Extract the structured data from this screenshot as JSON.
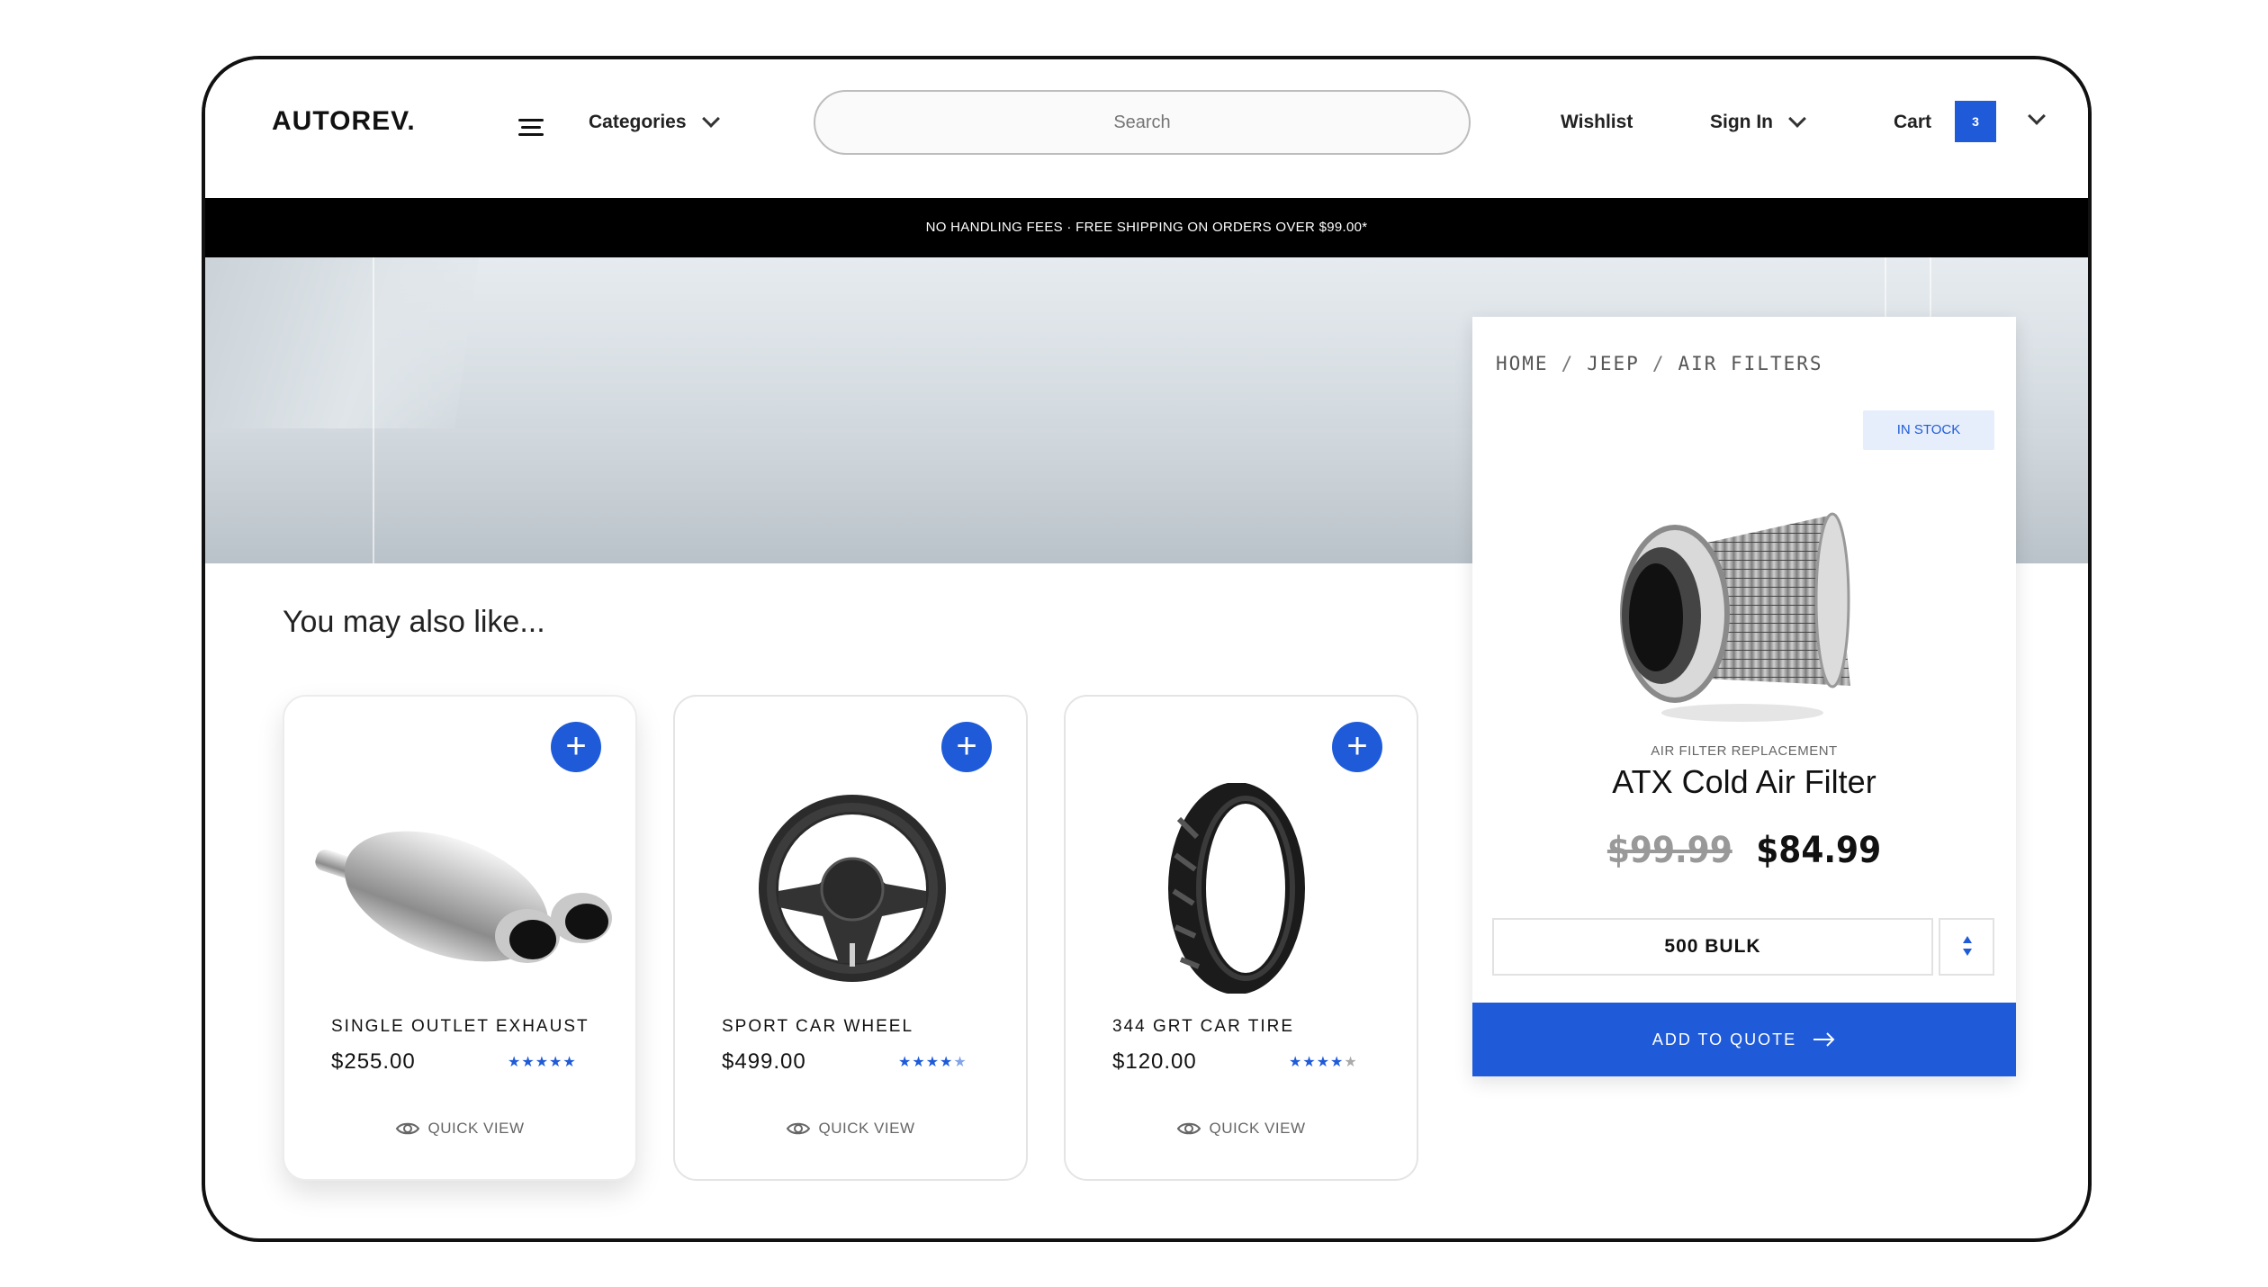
{
  "header": {
    "logo": "AUTOREV.",
    "categories_label": "Categories",
    "search_placeholder": "Search",
    "wishlist_label": "Wishlist",
    "signin_label": "Sign In",
    "cart_label": "Cart",
    "cart_count": "3"
  },
  "promo": {
    "text": "NO HANDLING FEES · FREE SHIPPING ON ORDERS OVER $99.00*"
  },
  "section": {
    "title": "You may also like..."
  },
  "products": [
    {
      "name": "SINGLE OUTLET EXHAUST",
      "price": "$255.00",
      "rating": 5,
      "quick_view": "QUICK VIEW",
      "icon": "exhaust"
    },
    {
      "name": "SPORT CAR WHEEL",
      "price": "$499.00",
      "rating": 4.5,
      "quick_view": "QUICK VIEW",
      "icon": "steering-wheel"
    },
    {
      "name": "344 GRT CAR TIRE",
      "price": "$120.00",
      "rating": 4,
      "quick_view": "QUICK VIEW",
      "icon": "tire"
    }
  ],
  "detail": {
    "breadcrumb": [
      "HOME",
      "JEEP",
      "AIR FILTERS"
    ],
    "stock_label": "IN STOCK",
    "subtitle": "AIR FILTER REPLACEMENT",
    "title": "ATX Cold Air Filter",
    "old_price": "$99.99",
    "new_price": "$84.99",
    "quantity_value": "500 BULK",
    "add_button": "ADD TO QUOTE"
  },
  "colors": {
    "accent": "#1f5bd8",
    "promo_bg": "#000000",
    "stock_bg": "#e6eefb"
  }
}
